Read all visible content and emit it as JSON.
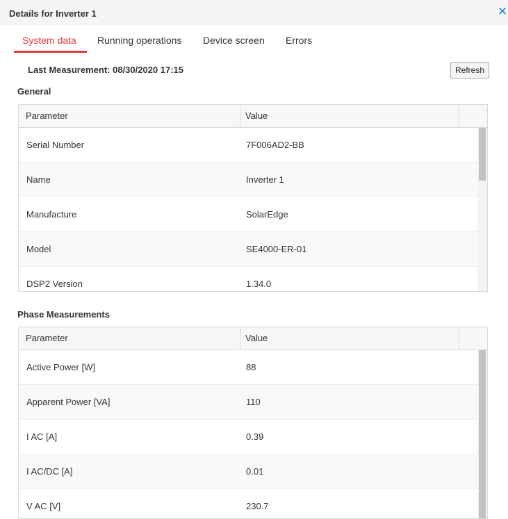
{
  "title": "Details for Inverter 1",
  "close_icon": "close-icon",
  "tabs": [
    {
      "label": "System data",
      "active": true
    },
    {
      "label": "Running operations",
      "active": false
    },
    {
      "label": "Device screen",
      "active": false
    },
    {
      "label": "Errors",
      "active": false
    }
  ],
  "last_measurement": "Last Measurement: 08/30/2020 17:15",
  "refresh_label": "Refresh",
  "accent_color": "#e53a3a",
  "close_color": "#2f80d3",
  "general": {
    "title": "General",
    "headers": {
      "parameter": "Parameter",
      "value": "Value"
    },
    "rows": [
      {
        "parameter": "Serial Number",
        "value": "7F006AD2-BB"
      },
      {
        "parameter": "Name",
        "value": "Inverter 1"
      },
      {
        "parameter": "Manufacture",
        "value": "SolarEdge"
      },
      {
        "parameter": "Model",
        "value": "SE4000-ER-01"
      },
      {
        "parameter": "DSP2 Version",
        "value": "1.34.0"
      }
    ]
  },
  "phase": {
    "title": "Phase Measurements",
    "headers": {
      "parameter": "Parameter",
      "value": "Value"
    },
    "rows": [
      {
        "parameter": "Active Power [W]",
        "value": "88"
      },
      {
        "parameter": "Apparent Power [VA]",
        "value": "110"
      },
      {
        "parameter": "I AC [A]",
        "value": "0.39"
      },
      {
        "parameter": "I AC/DC [A]",
        "value": "0.01"
      },
      {
        "parameter": "V AC [V]",
        "value": "230.7"
      }
    ]
  }
}
